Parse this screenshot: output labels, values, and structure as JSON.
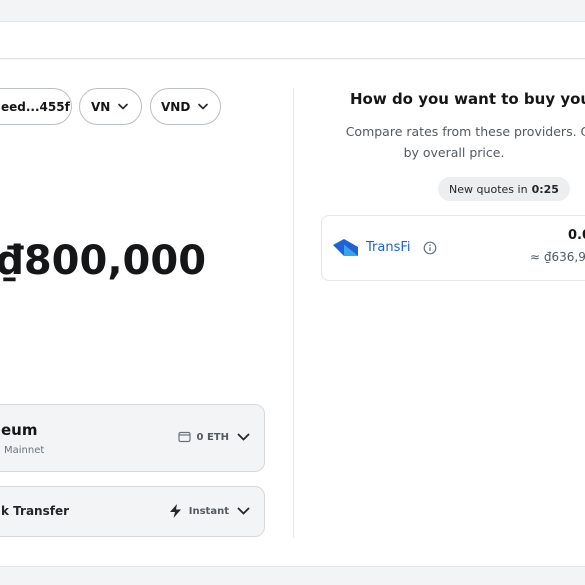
{
  "header": {
    "account_label": "eed...455f",
    "region_label": "VN",
    "currency_label": "VND"
  },
  "buy_form": {
    "amount": "₫800,000",
    "token": {
      "name": "eum",
      "network": "Mainnet",
      "balance": "0 ETH"
    },
    "payment": {
      "name": "k Transfer",
      "speed": "Instant"
    }
  },
  "quotes": {
    "title": "How do you want to buy you",
    "subtitle_line1": "Compare rates from these providers. Qu",
    "subtitle_line2": "by overall price.",
    "refresh_prefix": "New quotes in",
    "refresh_timer": "0:25",
    "providers": [
      {
        "name": "TransFi",
        "crypto_amount": "0.0",
        "fiat_amount": "≈ ₫636,9"
      }
    ]
  },
  "colors": {
    "accent": "#1c63d6",
    "text": "#141618",
    "muted": "#535a61"
  }
}
